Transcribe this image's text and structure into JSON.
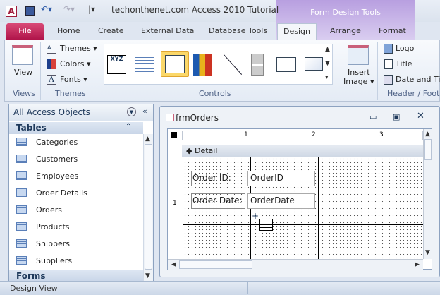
{
  "window": {
    "title": "techonthenet.com Access 2010 Tutorial",
    "context_tab": "Form Design Tools"
  },
  "tabs": [
    "File",
    "Home",
    "Create",
    "External Data",
    "Database Tools",
    "Design",
    "Arrange",
    "Format"
  ],
  "ribbon": {
    "views": {
      "view": "View",
      "label": "Views"
    },
    "themes": {
      "themes": "Themes",
      "colors": "Colors",
      "fonts": "Fonts",
      "label": "Themes"
    },
    "controls": {
      "label": "Controls",
      "gallery": [
        "label-icon",
        "list-box-icon",
        "combo-box-icon",
        "chart-icon",
        "line-icon",
        "toggle-button-icon",
        "list-spin-icon",
        "rectangle-icon"
      ],
      "selected": "combo-box-icon",
      "text_label": "XYZ"
    },
    "insert_image": {
      "line1": "Insert",
      "line2": "Image"
    },
    "header_footer": {
      "logo": "Logo",
      "title": "Title",
      "date_time": "Date and Tim",
      "label": "Header / Foote"
    }
  },
  "nav": {
    "header": "All Access Objects",
    "section": "Tables",
    "items": [
      "Categories",
      "Customers",
      "Employees",
      "Order Details",
      "Orders",
      "Products",
      "Shippers",
      "Suppliers"
    ],
    "next_section": "Forms"
  },
  "form": {
    "title": "frmOrders",
    "ruler": [
      "1",
      "2",
      "3"
    ],
    "vruler": "1",
    "section": "Detail",
    "controls": [
      {
        "label": "Order ID:",
        "field": "OrderID"
      },
      {
        "label": "Order Date:",
        "field": "OrderDate"
      }
    ]
  },
  "status": {
    "text": "Design View"
  }
}
